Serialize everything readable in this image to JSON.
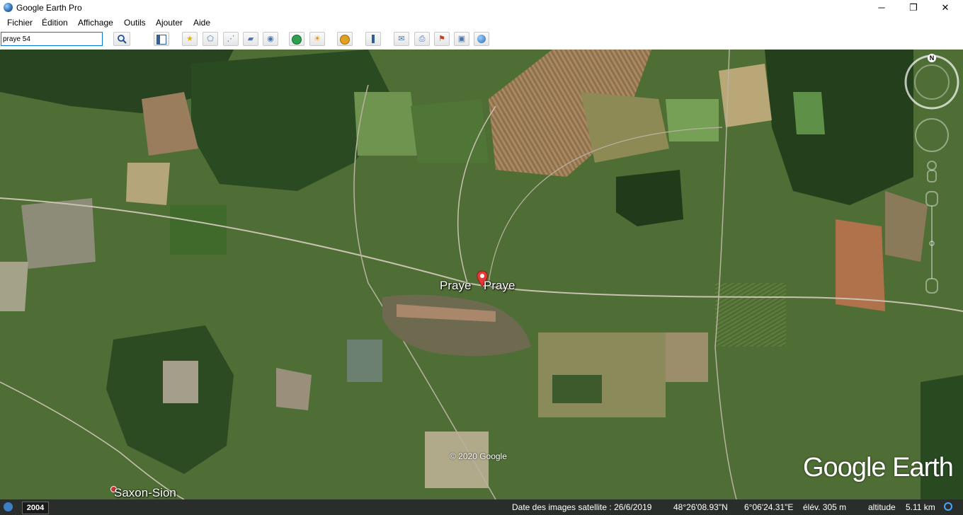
{
  "window": {
    "title": "Google Earth Pro",
    "minimize": "─",
    "maximize": "❐",
    "close": "✕"
  },
  "menu": [
    "Fichier",
    "Édition",
    "Affichage",
    "Outils",
    "Ajouter",
    "Aide"
  ],
  "search": {
    "value": "praye 54"
  },
  "map": {
    "places": [
      {
        "label": "Praye"
      },
      {
        "label": "Praye"
      },
      {
        "label": "Saxon-Sion"
      }
    ],
    "copyright": "© 2020 Google",
    "logo": "Google Earth",
    "compass_north": "N"
  },
  "status": {
    "year": "2004",
    "imagery_date": "Date des images satellite : 26/6/2019",
    "latitude": "48°26'08.93\"N",
    "longitude": "6°06'24.31\"E",
    "elevation": "élév.  305 m",
    "altitude_label": "altitude",
    "altitude_value": "5.11 km"
  }
}
